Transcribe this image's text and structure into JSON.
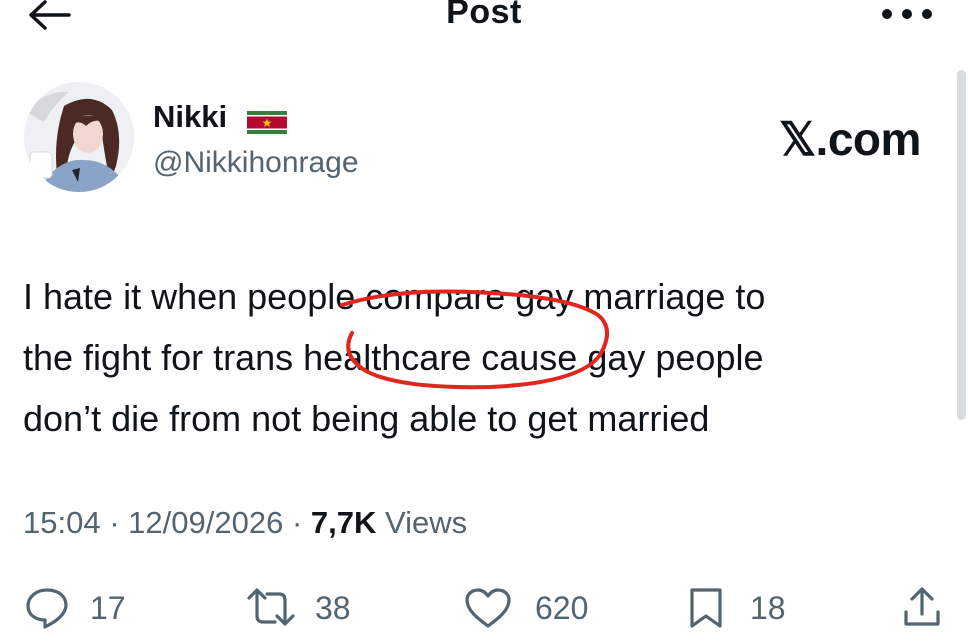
{
  "header": {
    "title": "Post",
    "back_icon": "arrow-left-icon",
    "more_icon": "more-horizontal-icon"
  },
  "author": {
    "display_name": "Nikki",
    "flag": "suriname-flag-icon",
    "handle": "@Nikkihonrage"
  },
  "brand": {
    "wordmark": "𝕏.com"
  },
  "post": {
    "lines": [
      "I hate it when people compare gay marriage to",
      "the fight for trans healthcare cause gay people",
      "don’t die from not being able to get married"
    ],
    "annotation": {
      "shape": "hand-drawn-circle",
      "color": "#e0261f"
    }
  },
  "meta": {
    "time": "15:04",
    "separator": "·",
    "date": "12/09/2026",
    "views_count": "7,7K",
    "views_label": "Views"
  },
  "actions": {
    "replies": {
      "icon": "reply-icon",
      "count": "17"
    },
    "reposts": {
      "icon": "repost-icon",
      "count": "38"
    },
    "likes": {
      "icon": "heart-icon",
      "count": "620"
    },
    "bookmarks": {
      "icon": "bookmark-icon",
      "count": "18"
    },
    "share": {
      "icon": "share-icon"
    }
  },
  "colors": {
    "text": "#0f1419",
    "secondary": "#536471",
    "annotation": "#e0261f"
  }
}
